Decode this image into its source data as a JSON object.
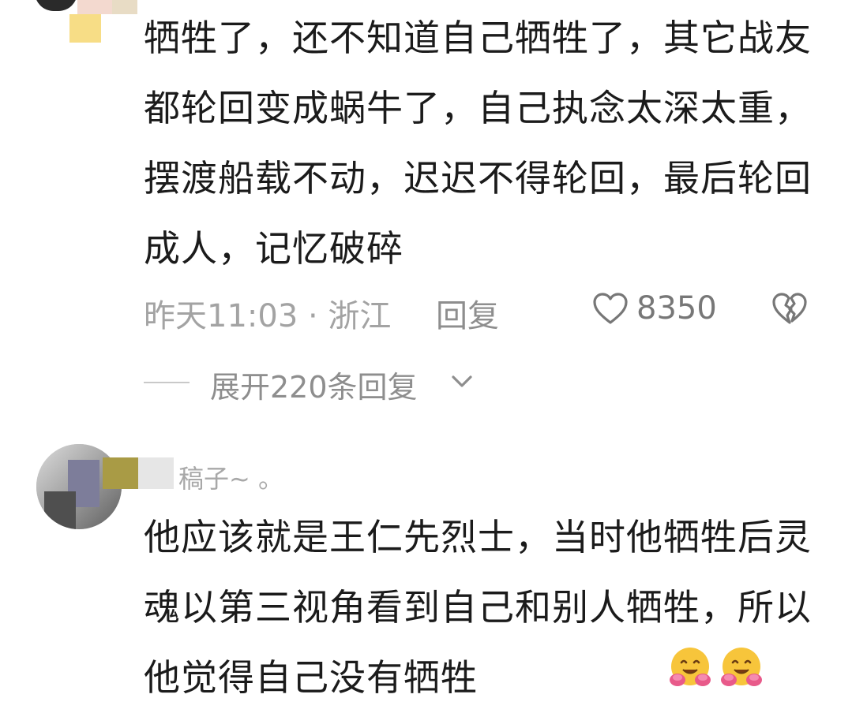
{
  "comment1": {
    "text": "牺牲了，还不知道自己牺牲了，其它战友都轮回变成蜗牛了，自己执念太深太重，摆渡船载不动，迟迟不得轮回，最后轮回成人，记忆破碎",
    "time_location": "昨天11:03 · 浙江",
    "reply_label": "回复",
    "like_count": "8350",
    "expand_replies_label": "展开220条回复"
  },
  "comment2": {
    "username": "稿子~ 。",
    "text": "他应该就是王仁先烈士，当时他牺牲后灵魂以第三视角看到自己和别人牺牲，所以他觉得自己没有牺牲"
  },
  "icons": {
    "like": "heart-outline-icon",
    "dislike": "broken-heart-icon",
    "expand": "chevron-down-icon",
    "emoji": "hugging-face-emoji"
  },
  "colors": {
    "text_primary": "#1b1b1b",
    "text_secondary": "#a3a3a3",
    "background": "#ffffff"
  }
}
